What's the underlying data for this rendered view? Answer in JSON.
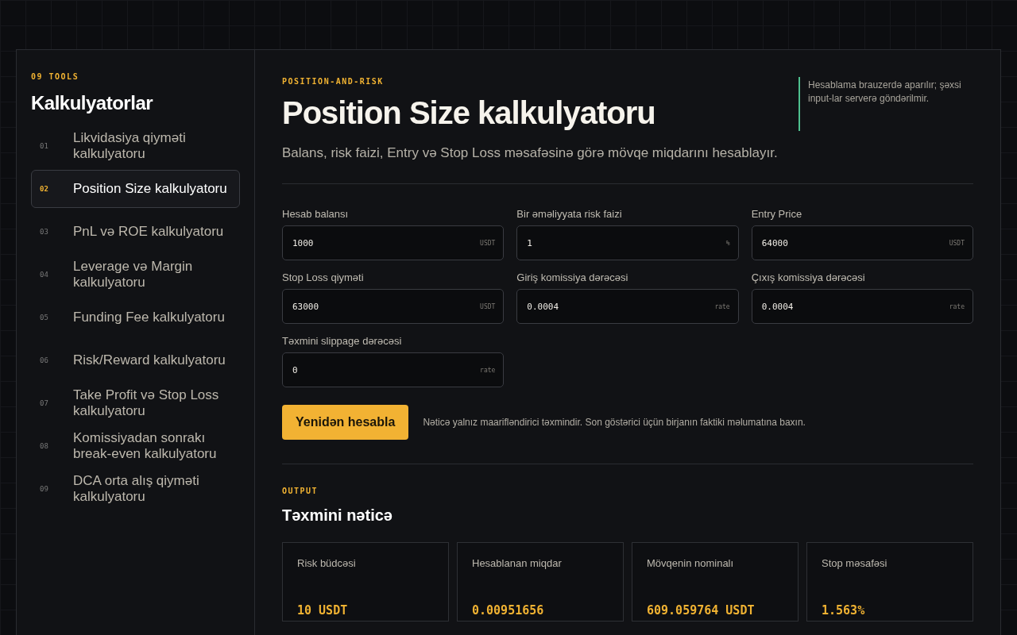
{
  "sidebar": {
    "eyebrow": "09 TOOLS",
    "title": "Kalkulyatorlar",
    "items": [
      {
        "number": "01",
        "label": "Likvidasiya qiymәti kalkulyatoru",
        "selected": false
      },
      {
        "number": "02",
        "label": "Position Size kalkulyatoru",
        "selected": true
      },
      {
        "number": "03",
        "label": "PnL vә ROE kalkulyatoru",
        "selected": false
      },
      {
        "number": "04",
        "label": "Leverage vә Margin kalkulyatoru",
        "selected": false
      },
      {
        "number": "05",
        "label": "Funding Fee kalkulyatoru",
        "selected": false
      },
      {
        "number": "06",
        "label": "Risk/Reward kalkulyatoru",
        "selected": false
      },
      {
        "number": "07",
        "label": "Take Profit vә Stop Loss kalkulyatoru",
        "selected": false
      },
      {
        "number": "08",
        "label": "Komissiyadan sonrakı break-even kalkulyatoru",
        "selected": false
      },
      {
        "number": "09",
        "label": "DCA orta alış qiymәti kalkulyatoru",
        "selected": false
      }
    ]
  },
  "header": {
    "eyebrow": "POSITION-AND-RISK",
    "title": "Position Size kalkulyatoru",
    "subtitle": "Balans, risk faizi, Entry vә Stop Loss mәsafәsinә görә mövqe miqdarını hesablayır.",
    "note": "Hesablama brauzerdә aparılır; şәxsi input-lar serverә göndәrilmir."
  },
  "fields": [
    {
      "label": "Hesab balansı",
      "value": "1000",
      "unit": "USDT"
    },
    {
      "label": "Bir әmәliyyata risk faizi",
      "value": "1",
      "unit": "%"
    },
    {
      "label": "Entry Price",
      "value": "64000",
      "unit": "USDT"
    },
    {
      "label": "Stop Loss qiymәti",
      "value": "63000",
      "unit": "USDT"
    },
    {
      "label": "Giriş komissiya dәrәcәsi",
      "value": "0.0004",
      "unit": "rate"
    },
    {
      "label": "Çıxış komissiya dәrәcәsi",
      "value": "0.0004",
      "unit": "rate"
    },
    {
      "label": "Tәxmini slippage dәrәcәsi",
      "value": "0",
      "unit": "rate"
    }
  ],
  "action": {
    "button": "Yenidәn hesabla",
    "disclaimer": "Nәticә yalnız maariflәndirici tәxmindir. Son göstәrici üçün birjanın faktiki mәlumatına baxın."
  },
  "output": {
    "eyebrow": "OUTPUT",
    "title": "Tәxmini nәticә",
    "cards": [
      {
        "label": "Risk büdcәsi",
        "value": "10 USDT"
      },
      {
        "label": "Hesablanan miqdar",
        "value": "0.00951656"
      },
      {
        "label": "Mövqenin nominalı",
        "value": "609.059764 USDT"
      },
      {
        "label": "Stop mәsafәsi",
        "value": "1.563%"
      }
    ]
  }
}
